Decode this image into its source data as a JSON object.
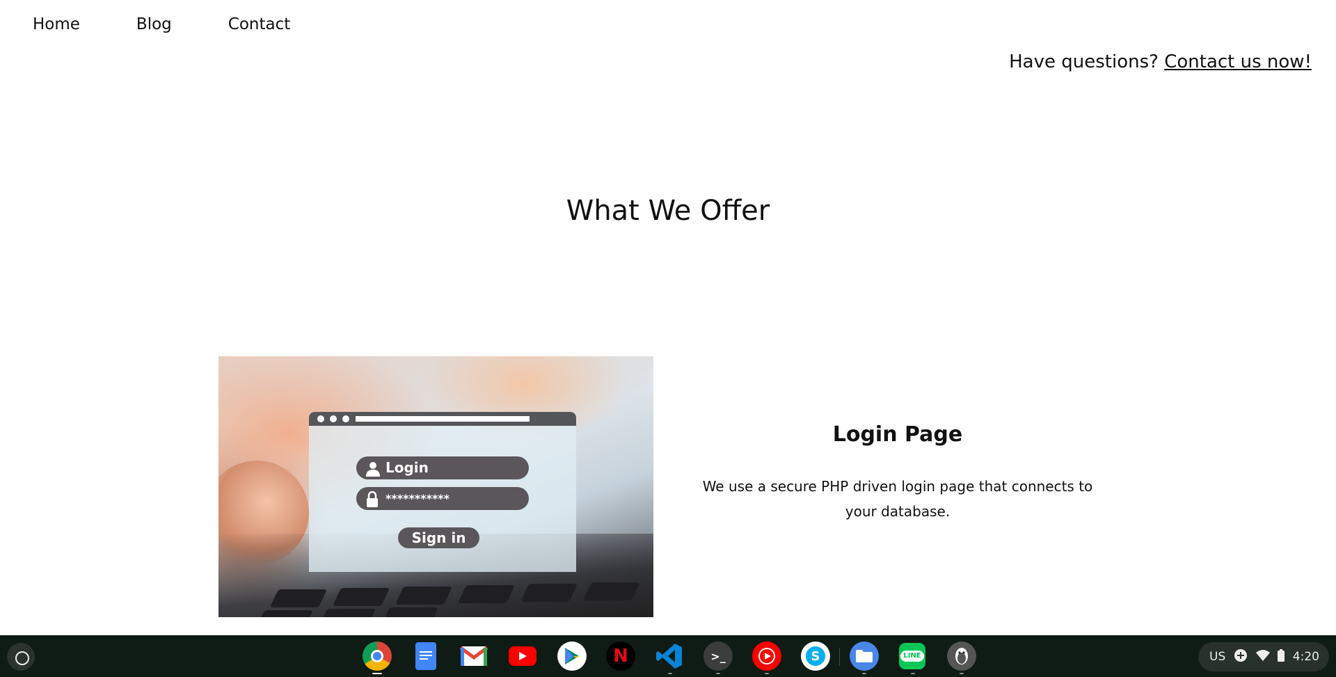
{
  "nav": {
    "items": [
      {
        "label": "Home"
      },
      {
        "label": "Blog"
      },
      {
        "label": "Contact"
      }
    ]
  },
  "header": {
    "question_text": "Have questions? ",
    "contact_link": "Contact us now!"
  },
  "section": {
    "title": "What We Offer"
  },
  "feature": {
    "image": {
      "login_label": "Login",
      "password_mask": "***********",
      "signin_label": "Sign in"
    },
    "title": "Login Page",
    "description": "We use a secure PHP driven login page that connects to your database."
  },
  "shelf": {
    "apps": [
      {
        "name": "chrome-icon",
        "color": "#db4437"
      },
      {
        "name": "google-docs-icon",
        "color": "#4285f4"
      },
      {
        "name": "gmail-icon",
        "color": "#ea4335"
      },
      {
        "name": "youtube-icon",
        "color": "#ff0000"
      },
      {
        "name": "play-store-icon",
        "color": "#01875f"
      },
      {
        "name": "netflix-icon",
        "color": "#e50914",
        "text": "N"
      },
      {
        "name": "vscode-icon",
        "color": "#007acc"
      },
      {
        "name": "terminal-icon",
        "color": "#3c3c3c",
        "text": ">_"
      },
      {
        "name": "youtube-music-icon",
        "color": "#ff0000"
      },
      {
        "name": "skype-icon",
        "color": "#00aff0",
        "text": "S"
      },
      {
        "name": "files-icon",
        "color": "#4a86e8"
      },
      {
        "name": "line-icon",
        "color": "#06c755",
        "text": "LINE"
      },
      {
        "name": "linux-penguin-icon",
        "color": "#444444"
      }
    ],
    "tray": {
      "keyboard": "US",
      "time": "4:20"
    }
  }
}
